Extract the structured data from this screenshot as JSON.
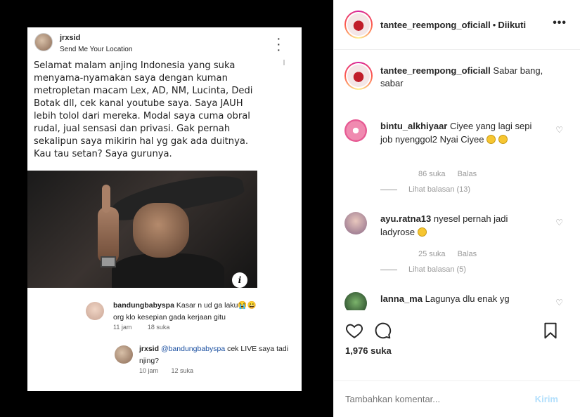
{
  "post_image": {
    "header": {
      "username": "jrxsid",
      "location": "Send Me Your Location",
      "more_icon": "more-vertical-icon"
    },
    "caption": "Selamat malam anjing Indonesia yang suka menyama-nyamakan saya dengan kuman metropletan macam Lex, AD, NM, Lucinta, Dedi Botak dll, cek kanal youtube saya. Saya JAUH lebih tolol dari mereka. Modal saya cuma obral rudal, jual sensasi dan privasi. Gak pernah sekalipun saya mikirin hal yg gak ada duitnya. Kau tau setan? Saya gurunya.",
    "info_glyph": "i",
    "comments": [
      {
        "username": "bandungbabyspa",
        "text_line1": "Kasar n ud ga laku😭😀",
        "text_line2": "org klo kesepian gada kerjaan gitu",
        "time": "11 jam",
        "likes": "18 suka"
      },
      {
        "username": "jrxsid",
        "mention": "@bandungbabyspa",
        "text": "cek LIVE saya tadi njing?",
        "time": "10 jam",
        "likes": "12 suka"
      }
    ]
  },
  "header": {
    "username": "tantee_reempong_oficiall",
    "separator": "•",
    "follow_status": "Diikuti",
    "more": "•••"
  },
  "caption": {
    "username": "tantee_reempong_oficiall",
    "text": "Sabar bang, sabar"
  },
  "comments": [
    {
      "username": "bintu_alkhiyaar",
      "text": "Ciyee yang lagi sepi job nyenggol2 Nyai Ciyee",
      "likes": "86 suka",
      "reply": "Balas",
      "view_replies": "Lihat balasan (13)"
    },
    {
      "username": "ayu.ratna13",
      "text": "nyesel pernah jadi ladyrose",
      "likes": "25 suka",
      "reply": "Balas",
      "view_replies": "Lihat balasan (5)"
    },
    {
      "username": "lanna_ma",
      "text": "Lagunya dlu enak yg"
    }
  ],
  "likes_count": "1,976 suka",
  "add_comment": {
    "placeholder": "Tambahkan komentar...",
    "post_label": "Kirim"
  },
  "colors": {
    "link": "#1a4fa0",
    "post_button_disabled": "#b2dffc",
    "muted": "#8e8e8e"
  }
}
